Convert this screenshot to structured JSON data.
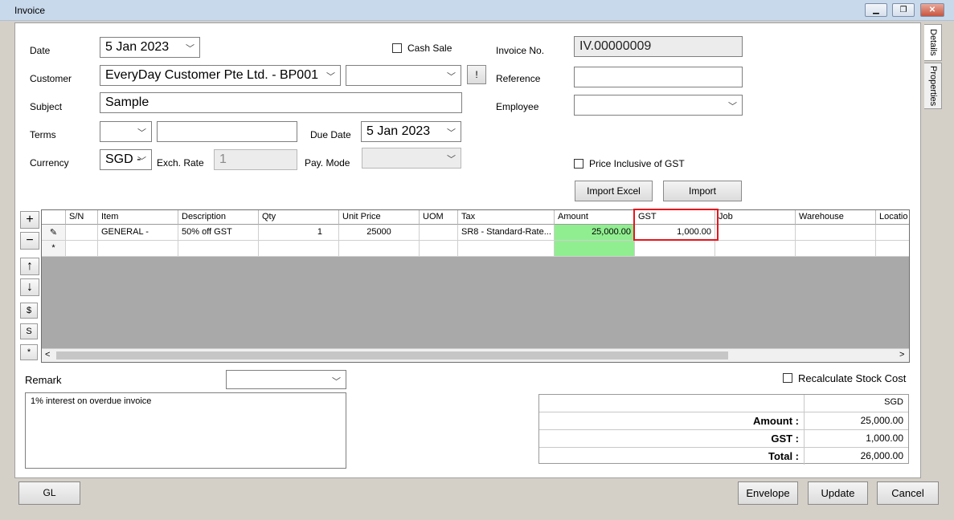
{
  "window": {
    "title": "Invoice",
    "min": "▁",
    "max": "❐",
    "close": "✕"
  },
  "form": {
    "date_label": "Date",
    "date_value": "5 Jan 2023",
    "cash_sale_label": "Cash Sale",
    "invoice_no_label": "Invoice No.",
    "invoice_no_value": "IV.00000009",
    "customer_label": "Customer",
    "customer_value": "EveryDay Customer Pte Ltd. - BP001",
    "customer_extra_btn": "!",
    "reference_label": "Reference",
    "subject_label": "Subject",
    "subject_value": "Sample",
    "employee_label": "Employee",
    "terms_label": "Terms",
    "due_date_label": "Due Date",
    "due_date_value": "5 Jan 2023",
    "currency_label": "Currency",
    "currency_value": "SGD -",
    "exch_rate_label": "Exch. Rate",
    "exch_rate_value": "1",
    "pay_mode_label": "Pay. Mode",
    "price_incl_gst_label": "Price Inclusive of GST",
    "import_excel_label": "Import Excel",
    "import_label": "Import"
  },
  "side_tabs": {
    "details": "Details",
    "properties": "Properties"
  },
  "toolbar": {
    "add": "+",
    "remove": "−",
    "up": "↑",
    "down": "↓",
    "dollar": "$",
    "s": "S",
    "star": "*"
  },
  "grid": {
    "columns": [
      "S/N",
      "Item",
      "Description",
      "Qty",
      "Unit Price",
      "UOM",
      "Tax",
      "Amount",
      "GST",
      "Job",
      "Warehouse",
      "Locatio"
    ],
    "rows": [
      {
        "marker": "✎",
        "sn": "",
        "item": "GENERAL -",
        "description": "50% off GST",
        "qty": "1",
        "unit_price": "25000",
        "uom": "",
        "tax": "SR8 - Standard-Rate...",
        "amount": "25,000.00",
        "gst": "1,000.00",
        "job": "",
        "warehouse": "",
        "location": ""
      }
    ],
    "new_row_marker": "*",
    "scroll_left": "<",
    "scroll_right": ">"
  },
  "remark": {
    "label": "Remark",
    "text": "1% interest on overdue invoice"
  },
  "recalc_label": "Recalculate Stock Cost",
  "totals": {
    "currency": "SGD",
    "amount_label": "Amount :",
    "amount_value": "25,000.00",
    "gst_label": "GST :",
    "gst_value": "1,000.00",
    "total_label": "Total :",
    "total_value": "26,000.00"
  },
  "buttons": {
    "gl": "GL",
    "envelope": "Envelope",
    "update": "Update",
    "cancel": "Cancel"
  },
  "colors": {
    "highlight": "#e8141c",
    "amount_bg": "#90ee90"
  }
}
